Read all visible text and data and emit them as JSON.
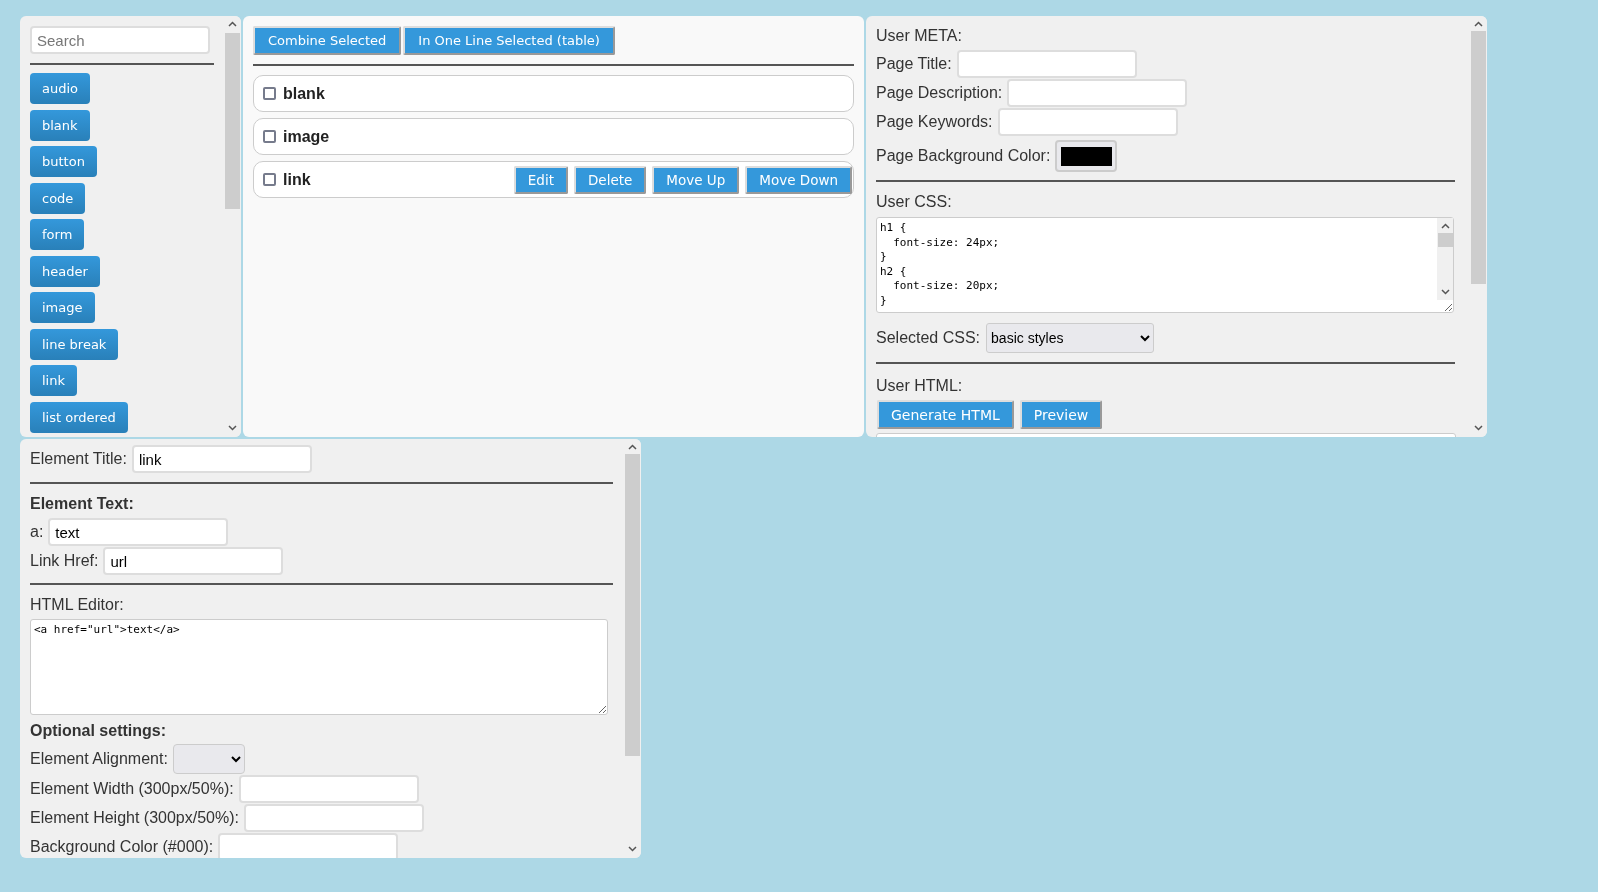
{
  "sidebar": {
    "search": {
      "placeholder": "Search"
    },
    "items": [
      "audio",
      "blank",
      "button",
      "code",
      "form",
      "header",
      "image",
      "line break",
      "link",
      "list ordered"
    ]
  },
  "toolbar": {
    "buttons": [
      "Combine Selected",
      "In One Line Selected (table)"
    ]
  },
  "elements": [
    {
      "title": "blank",
      "checked": false
    },
    {
      "title": "image",
      "checked": false
    },
    {
      "title": "link",
      "checked": false,
      "actions": [
        "Edit",
        "Delete",
        "Move Up",
        "Move Down"
      ]
    }
  ],
  "meta": {
    "heading": "User META:",
    "fields": [
      {
        "label": "Page Title:",
        "kind": "text"
      },
      {
        "label": "Page Description:",
        "kind": "text"
      },
      {
        "label": "Page Keywords:",
        "kind": "text"
      },
      {
        "label": "Page Background Color:",
        "kind": "color",
        "color": "#000000"
      }
    ]
  },
  "css": {
    "heading": "User CSS:",
    "code": "h1 {\n  font-size: 24px;\n}\nh2 {\n  font-size: 20px;\n}",
    "selected_label": "Selected CSS:",
    "selected_value": "basic styles"
  },
  "html": {
    "heading": "User HTML:",
    "buttons": [
      "Generate HTML",
      "Preview"
    ]
  },
  "editor": {
    "title_label": "Element Title:",
    "title_value": "link",
    "text_heading": "Element Text:",
    "text_fields": [
      {
        "label": "a:",
        "value": "text"
      },
      {
        "label": "Link Href:",
        "value": "url"
      }
    ],
    "html_label": "HTML Editor:",
    "html_code": "<a href=\"url\">text</a>",
    "optional_heading": "Optional settings:",
    "settings": [
      {
        "label": "Element Alignment:",
        "kind": "select"
      },
      {
        "label": "Element Width (300px/50%):",
        "kind": "text"
      },
      {
        "label": "Element Height (300px/50%):",
        "kind": "text"
      },
      {
        "label": "Background Color (#000):",
        "kind": "text"
      }
    ]
  }
}
